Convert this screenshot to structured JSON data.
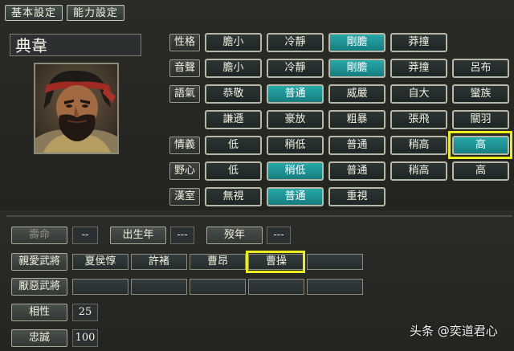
{
  "tabs": [
    "基本設定",
    "能力設定"
  ],
  "general": {
    "name": "典韋"
  },
  "personality": {
    "rows": [
      {
        "label": "性格",
        "options": [
          "膽小",
          "冷靜",
          "剛膽",
          "莽撞"
        ],
        "selected": 2
      },
      {
        "label": "音聲",
        "options": [
          "膽小",
          "冷靜",
          "剛膽",
          "莽撞",
          "呂布"
        ],
        "selected": 2
      },
      {
        "label": "語氣",
        "options": [
          "恭敬",
          "普通",
          "威嚴",
          "自大",
          "蠻族",
          "謙遜",
          "豪放",
          "粗暴",
          "張飛",
          "關羽"
        ],
        "selected": 1
      },
      {
        "label": "情義",
        "options": [
          "低",
          "稍低",
          "普通",
          "稍高",
          "高"
        ],
        "selected": 4,
        "highlighted": 4
      },
      {
        "label": "野心",
        "options": [
          "低",
          "稍低",
          "普通",
          "稍高",
          "高"
        ],
        "selected": 1
      },
      {
        "label": "漢室",
        "options": [
          "無視",
          "普通",
          "重視"
        ],
        "selected": 1
      }
    ]
  },
  "bottom": {
    "lifespan": {
      "label": "壽命",
      "value": "--"
    },
    "birth": {
      "label": "出生年",
      "value": "---"
    },
    "death": {
      "label": "歿年",
      "value": "---"
    },
    "liked": {
      "label": "親愛武將",
      "names": [
        "夏侯惇",
        "許褚",
        "曹昂",
        "曹操",
        ""
      ],
      "highlighted": 3
    },
    "disliked": {
      "label": "厭惡武將",
      "names": [
        "",
        "",
        "",
        "",
        ""
      ]
    },
    "compat": {
      "label": "相性",
      "value": "25"
    },
    "loyalty": {
      "label": "忠誠",
      "value": "100"
    }
  },
  "watermark": "头条 @奕道君心",
  "colors": {
    "selected": "#1f9a9c",
    "highlight": "#ecec1c"
  }
}
